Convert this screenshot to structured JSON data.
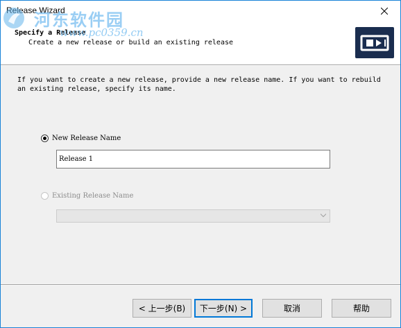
{
  "window": {
    "title": "Release Wizard"
  },
  "watermark": {
    "site_name": "河东软件园",
    "url": "www.pc0359.cn"
  },
  "header": {
    "title": "Specify a Release",
    "subtitle": "Create a new release or build an existing release",
    "logo_icon": "release-wizard-logo-icon"
  },
  "body": {
    "description": "If you want to create a new release, provide a new release name. If you want to rebuild an existing release, specify its name.",
    "new_release": {
      "label": "New Release Name",
      "selected": true,
      "value": "Release 1"
    },
    "existing_release": {
      "label": "Existing Release Name",
      "enabled": false,
      "value": ""
    }
  },
  "buttons": {
    "back": "< 上一步(B)",
    "next": "下一步(N) >",
    "cancel": "取消",
    "help": "帮助"
  },
  "colors": {
    "window_border": "#1883d7",
    "logo_background": "#1a2d4f",
    "default_button_border": "#0078d7",
    "watermark": "#78bef0"
  }
}
